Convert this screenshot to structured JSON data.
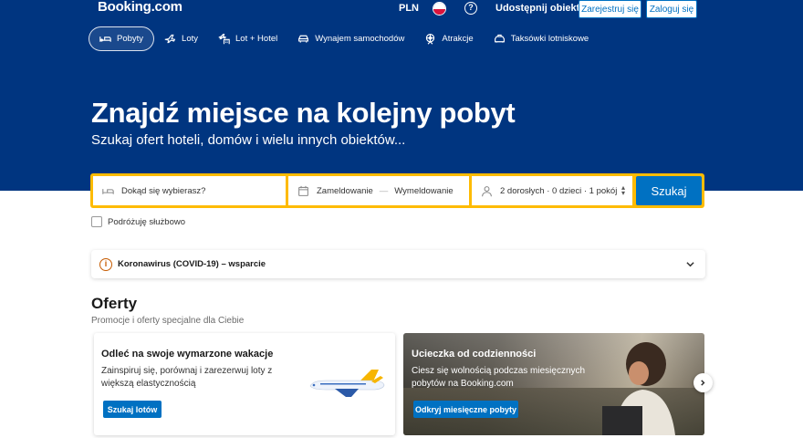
{
  "header": {
    "logo": "Booking.com",
    "currency": "PLN",
    "help_icon": "question-circle-icon",
    "list_property": "Udostępnij obiekt",
    "register": "Zarejestruj się",
    "login": "Zaloguj się",
    "colors": {
      "brand_blue": "#003580",
      "accent_yellow": "#febb02",
      "button_blue": "#0071c2"
    }
  },
  "nav": {
    "items": [
      {
        "label": "Pobyty",
        "icon": "bed-icon",
        "active": true
      },
      {
        "label": "Loty",
        "icon": "plane-icon",
        "active": false
      },
      {
        "label": "Lot + Hotel",
        "icon": "plane-hotel-icon",
        "active": false
      },
      {
        "label": "Wynajem samochodów",
        "icon": "car-icon",
        "active": false
      },
      {
        "label": "Atrakcje",
        "icon": "attractions-icon",
        "active": false
      },
      {
        "label": "Taksówki lotniskowe",
        "icon": "taxi-icon",
        "active": false
      }
    ]
  },
  "hero": {
    "headline": "Znajdź miejsce na kolejny pobyt",
    "subline": "Szukaj ofert hoteli, domów i wielu innych obiektów..."
  },
  "search": {
    "destination_placeholder": "Dokąd się wybierasz?",
    "checkin": "Zameldowanie",
    "dash": "—",
    "checkout": "Wymeldowanie",
    "guests": "2 dorosłych · 0 dzieci · 1 pokój",
    "button": "Szukaj"
  },
  "business_travel": {
    "label": "Podróżuję służbowo",
    "checked": false
  },
  "covid": {
    "icon_glyph": "i",
    "text": "Koronawirus (COVID-19) – wsparcie"
  },
  "offers": {
    "title": "Oferty",
    "subtitle": "Promocje i oferty specjalne dla Ciebie",
    "cards": [
      {
        "title": "Odleć na swoje wymarzone wakacje",
        "text": "Zainspiruj się, porównaj i zarezerwuj loty z większą elastycznością",
        "button": "Szukaj lotów"
      },
      {
        "title": "Ucieczka od codzienności",
        "text": "Ciesz się wolnością podczas miesięcznych pobytów na Booking.com",
        "button": "Odkryj miesięczne pobyty"
      }
    ]
  }
}
